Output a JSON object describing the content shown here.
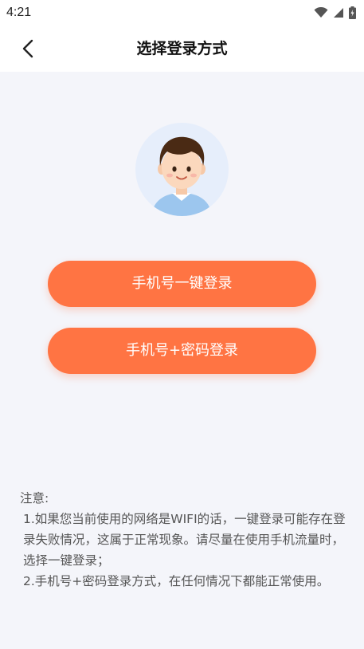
{
  "status_bar": {
    "time": "4:21"
  },
  "header": {
    "title": "选择登录方式"
  },
  "buttons": {
    "one_key_login": "手机号一键登录",
    "password_login": "手机号+密码登录"
  },
  "notes": {
    "heading": "注意:",
    "item1": "1.如果您当前使用的网络是WIFI的话，一键登录可能存在登录失败情况，这属于正常现象。请尽量在使用手机流量时，选择一键登录；",
    "item2": "2.手机号+密码登录方式，在任何情况下都能正常使用。"
  },
  "colors": {
    "accent": "#ff7443",
    "background": "#f4f5fa",
    "avatar_bg": "#e6eefb"
  }
}
